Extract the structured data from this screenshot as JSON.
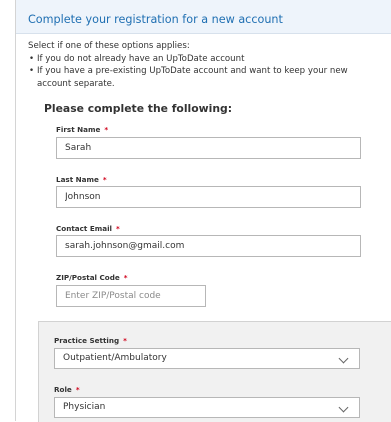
{
  "form": {
    "title": "Complete your registration for a new account",
    "intro_text": "Select if one of these options applies:",
    "options": [
      "If you do not already have an UpToDate account",
      "If you have a pre-existing UpToDate account and want to keep your new account separate."
    ],
    "subheading": "Please complete the following:",
    "required_marker": "*",
    "fields": {
      "first_name": {
        "label": "First Name",
        "value": "Sarah"
      },
      "last_name": {
        "label": "Last Name",
        "value": "Johnson"
      },
      "contact_email": {
        "label": "Contact Email",
        "value": "sarah.johnson@gmail.com"
      },
      "zip": {
        "label": "ZIP/Postal Code",
        "value": "",
        "placeholder": "Enter ZIP/Postal code"
      }
    },
    "practice": {
      "setting": {
        "label": "Practice Setting",
        "selected": "Outpatient/Ambulatory"
      },
      "role": {
        "label": "Role",
        "selected": "Physician"
      }
    }
  },
  "colors": {
    "title": "#1f6fb2",
    "required": "#d0021b",
    "header_bg": "#eef4fb"
  }
}
